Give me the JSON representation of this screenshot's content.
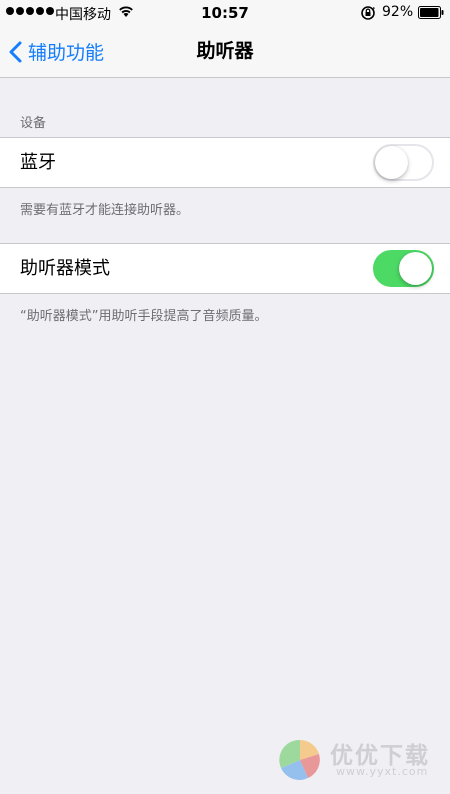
{
  "status_bar": {
    "carrier": "中国移动",
    "time": "10:57",
    "battery_percent": "92%",
    "signal_bars": 5,
    "icons": [
      "wifi-icon",
      "orientation-lock-icon",
      "battery-icon"
    ]
  },
  "nav": {
    "back_label": "辅助功能",
    "title": "助听器",
    "accent_color": "#157efb"
  },
  "sections": {
    "devices_header": "设备",
    "bluetooth": {
      "label": "蓝牙",
      "state": "off",
      "footer": "需要有蓝牙才能连接助听器。"
    },
    "hearing_aid_mode": {
      "label": "助听器模式",
      "state": "on",
      "on_color": "#4cd964",
      "footer": "“助听器模式”用助听手段提高了音频质量。"
    }
  },
  "watermark": {
    "text": "优优下载",
    "url": "www.yyxt.com"
  }
}
